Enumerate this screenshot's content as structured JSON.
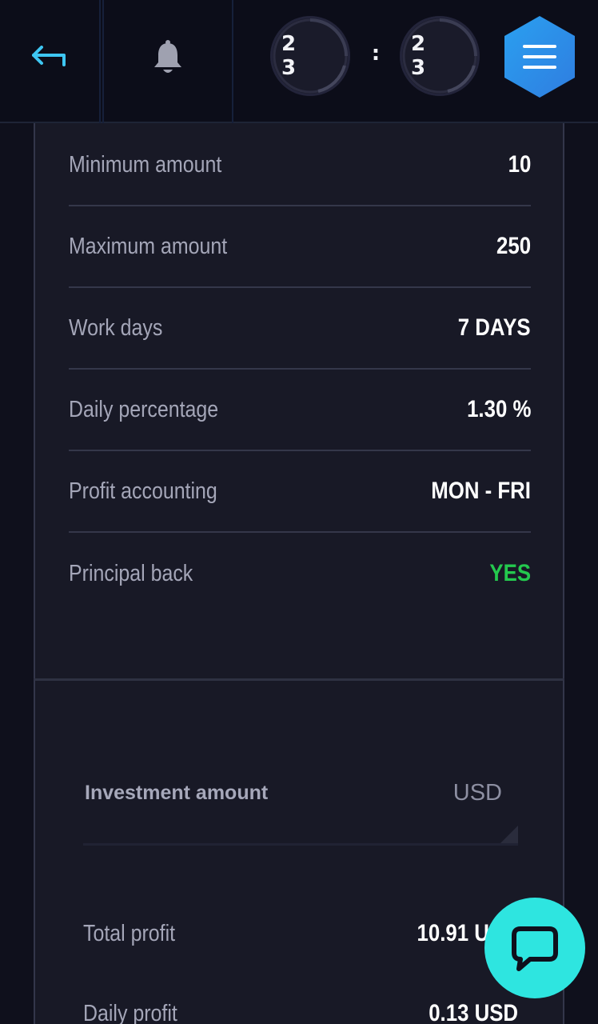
{
  "header": {
    "timer": {
      "hours": "2 3",
      "separator": ":",
      "minutes": "2 3"
    },
    "accent_color": "#3ec6f2",
    "menu_color": "#2f8de8"
  },
  "plan_details": [
    {
      "label": "Minimum amount",
      "value": "10"
    },
    {
      "label": "Maximum amount",
      "value": "250"
    },
    {
      "label": "Work days",
      "value": "7 DAYS"
    },
    {
      "label": "Daily percentage",
      "value": "1.30 %"
    },
    {
      "label": "Profit accounting",
      "value": "MON - FRI"
    },
    {
      "label": "Principal back",
      "value": "YES"
    }
  ],
  "calculator": {
    "investment_label": "Investment amount",
    "currency": "USD",
    "total_profit": {
      "label": "Total profit",
      "value": "10.91 USD"
    },
    "daily_profit": {
      "label": "Daily profit",
      "value": "0.13 USD"
    }
  },
  "colors": {
    "positive": "#24c94e",
    "chat": "#2ee5e0"
  }
}
